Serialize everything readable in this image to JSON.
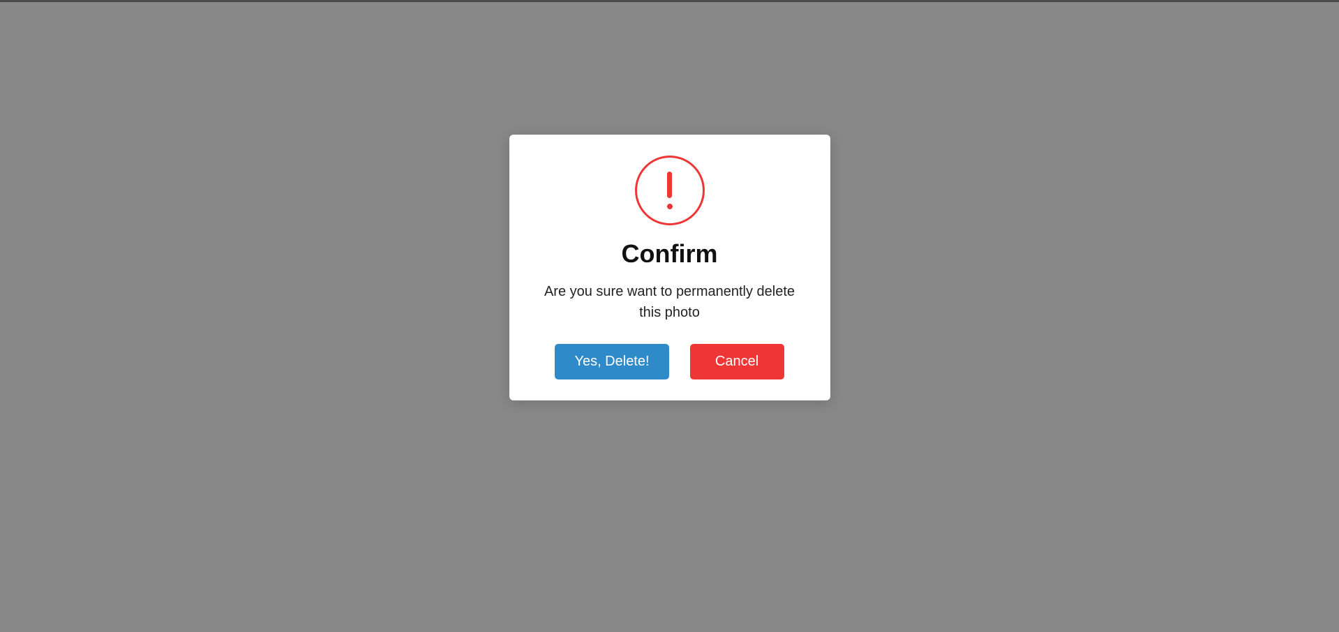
{
  "modal": {
    "icon": "warning-exclamation-icon",
    "title": "Confirm",
    "message": "Are you sure want to permanently delete this photo",
    "confirm_label": "Yes, Delete!",
    "cancel_label": "Cancel",
    "colors": {
      "confirm_button": "#2f8ac9",
      "cancel_button": "#ef3636",
      "icon_color": "#ef3636"
    }
  }
}
